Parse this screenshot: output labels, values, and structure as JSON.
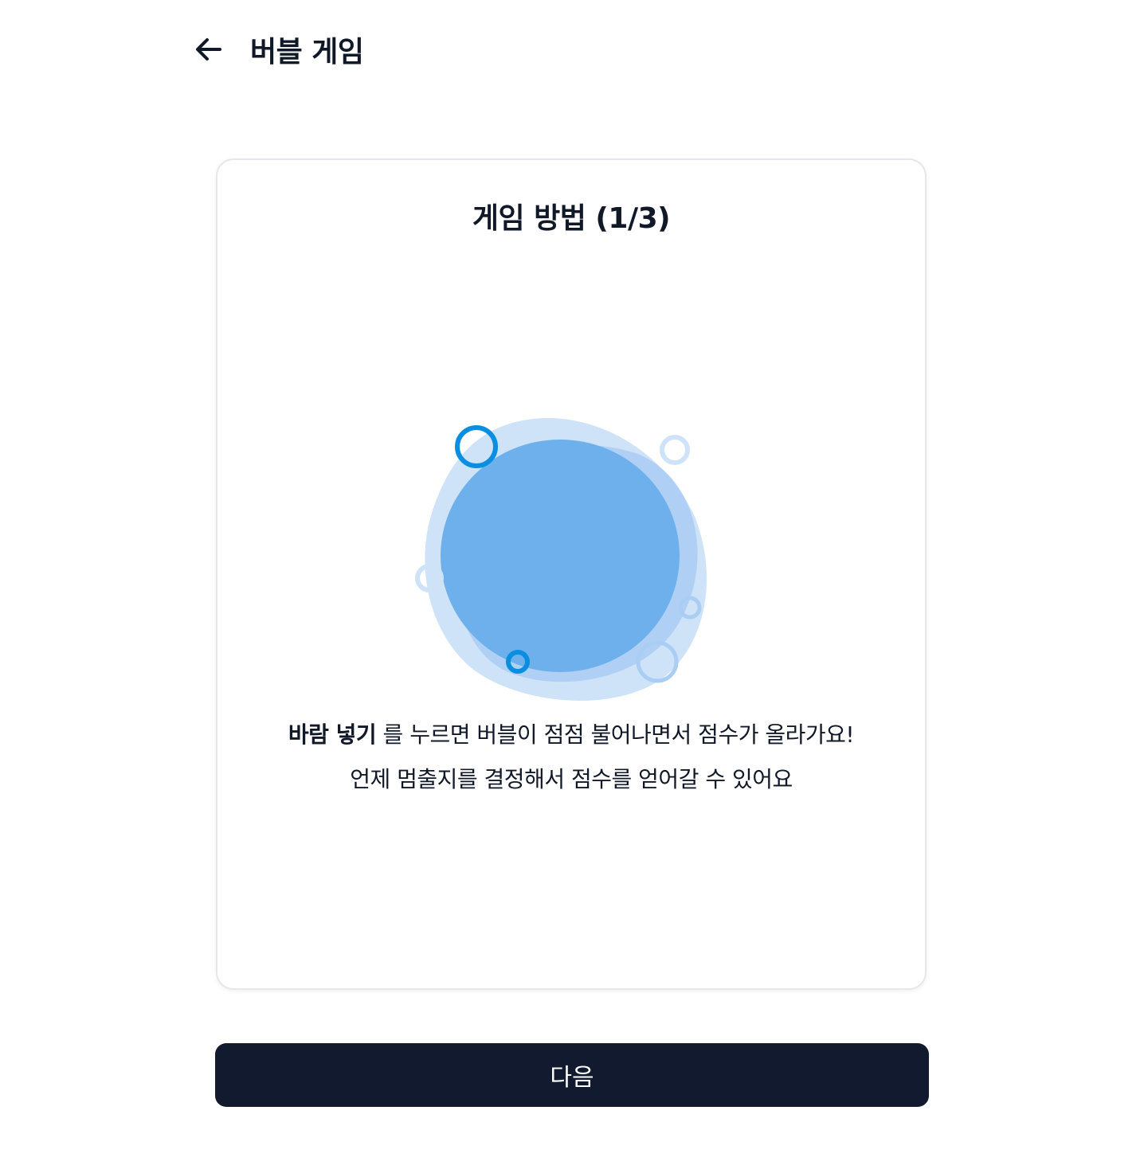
{
  "header": {
    "title": "버블 게임",
    "back_icon": "arrow-left-icon"
  },
  "card": {
    "title": "게임 방법 (1/3)",
    "description": {
      "highlight": "바람 넣기",
      "line1_rest": " 를 누르면 버블이 점점 불어나면서 점수가 올라가요!",
      "line2": "언제 멈출지를 결정해서 점수를 얻어갈 수 있어요"
    },
    "illustration_icon": "bubble-illustration"
  },
  "footer": {
    "next_label": "다음"
  },
  "colors": {
    "primary_dark": "#111a2e",
    "bubble_main": "#6eb0ec",
    "bubble_light": "#cfe3f8",
    "ring_accent": "#0a8ee0"
  }
}
